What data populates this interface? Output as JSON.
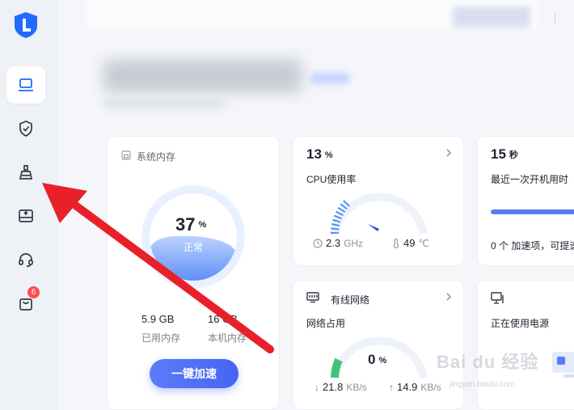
{
  "sidebar": {
    "items": [
      {
        "name": "computer",
        "icon": "laptop-icon",
        "active": true
      },
      {
        "name": "security",
        "icon": "shield-check-icon",
        "active": false
      },
      {
        "name": "cleanup",
        "icon": "broom-icon",
        "active": false
      },
      {
        "name": "toolbox",
        "icon": "box-upload-icon",
        "active": false
      },
      {
        "name": "support",
        "icon": "headset-icon",
        "active": false
      },
      {
        "name": "store",
        "icon": "bag-icon",
        "active": false,
        "badge": "6"
      }
    ]
  },
  "memory": {
    "title": "系统内存",
    "percent": "37",
    "percent_unit": "%",
    "status": "正常",
    "used_value": "5.9 GB",
    "used_label": "已用内存",
    "total_value": "16 GB",
    "total_label": "本机内存",
    "boost_label": "一键加速"
  },
  "cpu": {
    "value": "13",
    "unit": "%",
    "label": "CPU使用率",
    "freq_value": "2.3",
    "freq_unit": "GHz",
    "temp_value": "49",
    "temp_unit": "℃"
  },
  "boot": {
    "value": "15",
    "unit": "秒",
    "label": "最近一次开机用时",
    "progress": 1.0,
    "note": "0 个 加速项，可提速"
  },
  "network": {
    "title": "有线网络",
    "label": "网络占用",
    "percent": "0",
    "percent_unit": "%",
    "down_value": "21.8",
    "down_unit": "KB/s",
    "up_value": "14.9",
    "up_unit": "KB/s"
  },
  "power": {
    "label": "正在使用电源"
  },
  "watermark": {
    "text": "Bai du 经验",
    "sub": "jingyan.baidu.com"
  },
  "colors": {
    "accent": "#4764f2",
    "arrow": "#e8202a",
    "badge": "#ff4d4f",
    "down": "#2fb36b",
    "up": "#3a7bf0"
  }
}
